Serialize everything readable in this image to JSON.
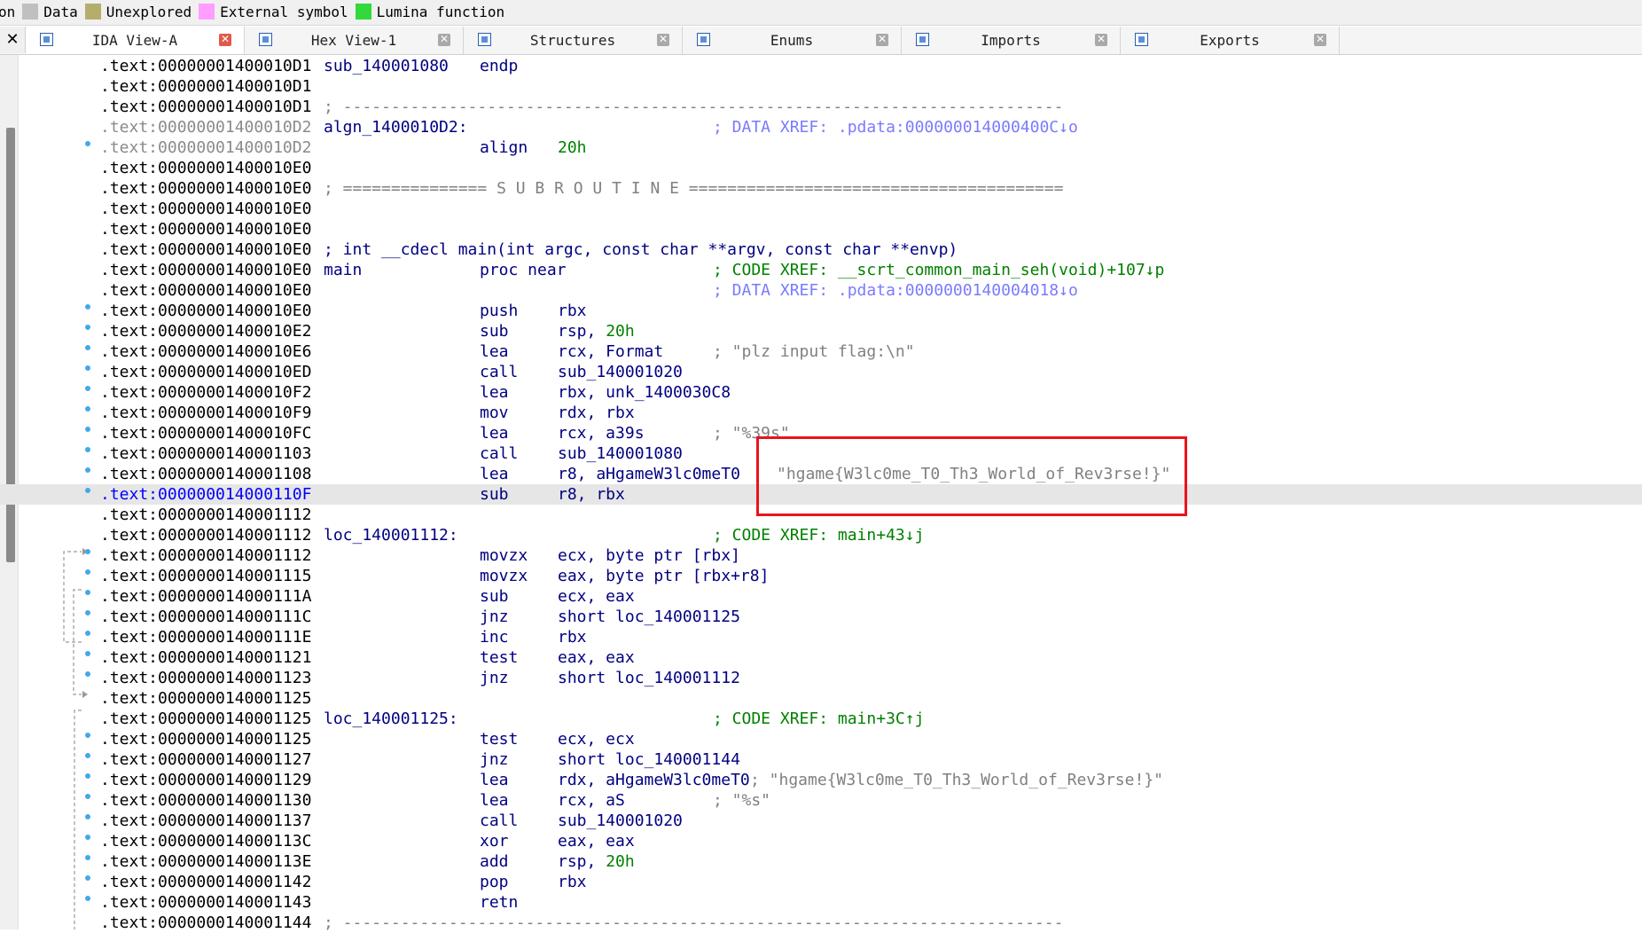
{
  "legend": [
    {
      "label": "on",
      "color": ""
    },
    {
      "label": "Data",
      "color": "#c0c0c0"
    },
    {
      "label": "Unexplored",
      "color": "#b5ad6d"
    },
    {
      "label": "External symbol",
      "color": "#ff9eff"
    },
    {
      "label": "Lumina function",
      "color": "#33d93c"
    }
  ],
  "tabs": [
    {
      "label": "IDA View-A",
      "icon": "ida-view-icon",
      "active": true
    },
    {
      "label": "Hex View-1",
      "icon": "hex-view-icon",
      "active": false
    },
    {
      "label": "Structures",
      "icon": "structures-icon",
      "active": false
    },
    {
      "label": "Enums",
      "icon": "enums-icon",
      "active": false
    },
    {
      "label": "Imports",
      "icon": "imports-icon",
      "active": false
    },
    {
      "label": "Exports",
      "icon": "exports-icon",
      "active": false
    }
  ],
  "close_all_glyph": "✕",
  "tab_close_glyph": "✕",
  "listing": [
    {
      "addr": ".text:00000001400010D1",
      "label": "sub_140001080",
      "mn": "endp",
      "op": ""
    },
    {
      "addr": ".text:00000001400010D1"
    },
    {
      "addr": ".text:00000001400010D1",
      "sep": "; ---------------------------------------------------------------------------"
    },
    {
      "addr": ".text:00000001400010D2",
      "addr_style": "gray",
      "label": "algn_1400010D2:",
      "xref": "; DATA XREF: .pdata:000000014000400C↓o",
      "xref_type": "data"
    },
    {
      "addr": ".text:00000001400010D2",
      "addr_style": "gray",
      "dot": true,
      "mn": "align",
      "op": "20h",
      "op_num": true
    },
    {
      "addr": ".text:00000001400010E0"
    },
    {
      "addr": ".text:00000001400010E0",
      "sep": "; =============== S U B R O U T I N E ======================================="
    },
    {
      "addr": ".text:00000001400010E0"
    },
    {
      "addr": ".text:00000001400010E0"
    },
    {
      "addr": ".text:00000001400010E0",
      "proto": "; int __cdecl main(int argc, const char **argv, const char **envp)"
    },
    {
      "addr": ".text:00000001400010E0",
      "label": "main",
      "mn": "proc near",
      "xref": "; CODE XREF: __scrt_common_main_seh(void)+107↓p",
      "xref_type": "code"
    },
    {
      "addr": ".text:00000001400010E0",
      "xref": "; DATA XREF: .pdata:0000000140004018↓o",
      "xref_type": "data"
    },
    {
      "addr": ".text:00000001400010E0",
      "dot": true,
      "mn": "push",
      "op": "rbx"
    },
    {
      "addr": ".text:00000001400010E2",
      "dot": true,
      "mn": "sub",
      "op": "rsp, ",
      "op_tail": "20h"
    },
    {
      "addr": ".text:00000001400010E6",
      "dot": true,
      "mn": "lea",
      "op": "rcx, Format",
      "cmt": "; \"plz input flag:\\n\""
    },
    {
      "addr": ".text:00000001400010ED",
      "dot": true,
      "mn": "call",
      "op": "sub_140001020"
    },
    {
      "addr": ".text:00000001400010F2",
      "dot": true,
      "mn": "lea",
      "op": "rbx, unk_1400030C8"
    },
    {
      "addr": ".text:00000001400010F9",
      "dot": true,
      "mn": "mov",
      "op": "rdx, rbx"
    },
    {
      "addr": ".text:00000001400010FC",
      "dot": true,
      "mn": "lea",
      "op": "rcx, a39s",
      "cmt": "; \"%39s\""
    },
    {
      "addr": ".text:0000000140001103",
      "dot": true,
      "mn": "call",
      "op": "sub_140001080"
    },
    {
      "addr": ".text:0000000140001108",
      "dot": true,
      "mn": "lea",
      "op": "r8, aHgameW3lc0meT0",
      "cmt2": "\"hgame{W3lc0me_T0_Th3_World_of_Rev3rse!}\""
    },
    {
      "addr": ".text:000000014000110F",
      "addr_style": "blue",
      "dot": true,
      "sel": true,
      "mn": "sub",
      "op": "r8, rbx"
    },
    {
      "addr": ".text:0000000140001112"
    },
    {
      "addr": ".text:0000000140001112",
      "label": "loc_140001112:",
      "xref": "; CODE XREF: main+43↓j",
      "xref_type": "code"
    },
    {
      "addr": ".text:0000000140001112",
      "dot": true,
      "mn": "movzx",
      "op": "ecx, byte ptr [rbx]"
    },
    {
      "addr": ".text:0000000140001115",
      "dot": true,
      "mn": "movzx",
      "op": "eax, byte ptr [rbx+r8]"
    },
    {
      "addr": ".text:000000014000111A",
      "dot": true,
      "mn": "sub",
      "op": "ecx, eax"
    },
    {
      "addr": ".text:000000014000111C",
      "dot": true,
      "mn": "jnz",
      "op": "short loc_140001125"
    },
    {
      "addr": ".text:000000014000111E",
      "dot": true,
      "mn": "inc",
      "op": "rbx"
    },
    {
      "addr": ".text:0000000140001121",
      "dot": true,
      "mn": "test",
      "op": "eax, eax"
    },
    {
      "addr": ".text:0000000140001123",
      "dot": true,
      "mn": "jnz",
      "op": "short loc_140001112"
    },
    {
      "addr": ".text:0000000140001125"
    },
    {
      "addr": ".text:0000000140001125",
      "label": "loc_140001125:",
      "xref": "; CODE XREF: main+3C↑j",
      "xref_type": "code"
    },
    {
      "addr": ".text:0000000140001125",
      "dot": true,
      "mn": "test",
      "op": "ecx, ecx"
    },
    {
      "addr": ".text:0000000140001127",
      "dot": true,
      "mn": "jnz",
      "op": "short loc_140001144"
    },
    {
      "addr": ".text:0000000140001129",
      "dot": true,
      "mn": "lea",
      "op": "rdx, aHgameW3lc0meT0",
      "cmt3": "; \"hgame{W3lc0me_T0_Th3_World_of_Rev3rse!}\""
    },
    {
      "addr": ".text:0000000140001130",
      "dot": true,
      "mn": "lea",
      "op": "rcx, aS",
      "cmt": "; \"%s\""
    },
    {
      "addr": ".text:0000000140001137",
      "dot": true,
      "mn": "call",
      "op": "sub_140001020"
    },
    {
      "addr": ".text:000000014000113C",
      "dot": true,
      "mn": "xor",
      "op": "eax, eax"
    },
    {
      "addr": ".text:000000014000113E",
      "dot": true,
      "mn": "add",
      "op": "rsp, ",
      "op_tail": "20h"
    },
    {
      "addr": ".text:0000000140001142",
      "dot": true,
      "mn": "pop",
      "op": "rbx"
    },
    {
      "addr": ".text:0000000140001143",
      "dot": true,
      "mn": "retn",
      "op": ""
    },
    {
      "addr": ".text:0000000140001144",
      "sep": "; ---------------------------------------------------------------------------"
    }
  ]
}
